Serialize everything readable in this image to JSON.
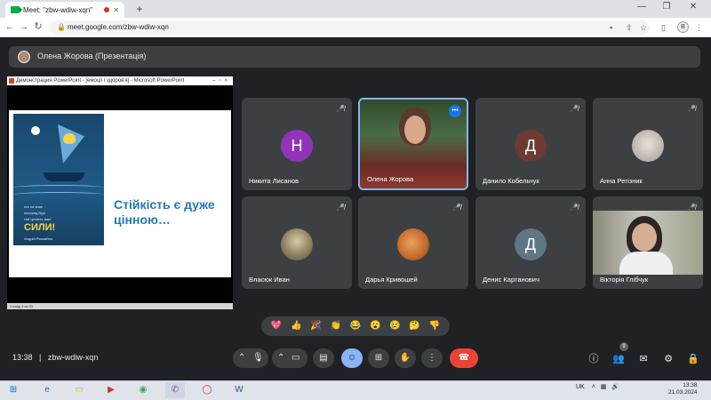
{
  "browser": {
    "tab_title": "Meet: \"zbw-wdiw-xqn\"",
    "tab_close": "✕",
    "new_tab": "+",
    "url": "meet.google.com/zbw-wdiw-xqn",
    "profile_letter": "B",
    "window_min": "—",
    "window_max": "❐",
    "window_close": "✕"
  },
  "presenter_bar": {
    "text": "Олена Жорова (Презентація)"
  },
  "presentation": {
    "window_title": "Демонстрация PowerPoint - [емоції і здоров'я] - Microsoft PowerPoint",
    "slide_text_line1": "Стійкість є дуже",
    "slide_text_line2": "цінною…",
    "poster_line1": "хто не знає",
    "poster_line2": "посеред бурі",
    "poster_line3": "той цінність ваєї",
    "poster_big": "СИЛИ!",
    "poster_author": "Андрій Рахмайло",
    "status": "Слайд 3 из 33"
  },
  "participants": [
    {
      "name": "Никита Лисанов",
      "initial": "Н",
      "color": "#9334b8"
    },
    {
      "name": "Олена Жорова",
      "initial": "",
      "color": "#7a4a2f"
    },
    {
      "name": "Данило Кобельчук",
      "initial": "Д",
      "color": "#6d3b34"
    },
    {
      "name": "Анна Регізник",
      "initial": "",
      "color": "#b6b0a8"
    },
    {
      "name": "Власюк Иван",
      "initial": "",
      "color": "#8a7a5a"
    },
    {
      "name": "Дарья Кривошей",
      "initial": "",
      "color": "#c06a2a"
    },
    {
      "name": "Денис Картанович",
      "initial": "Д",
      "color": "#5f7684"
    },
    {
      "name": "Вікторія Глібчук",
      "initial": "",
      "color": "#8a8a7a"
    }
  ],
  "reactions": [
    "💖",
    "👍",
    "🎉",
    "👏",
    "😂",
    "😮",
    "😢",
    "🤔",
    "👎"
  ],
  "controls": {
    "meeting_time": "13:38",
    "separator": "|",
    "meeting_code": "zbw-wdiw-xqn",
    "people_count": "9",
    "end_call_color": "#ea4335"
  },
  "taskbar": {
    "lang": "UK",
    "time": "13:38",
    "date": "21.03.2024"
  }
}
